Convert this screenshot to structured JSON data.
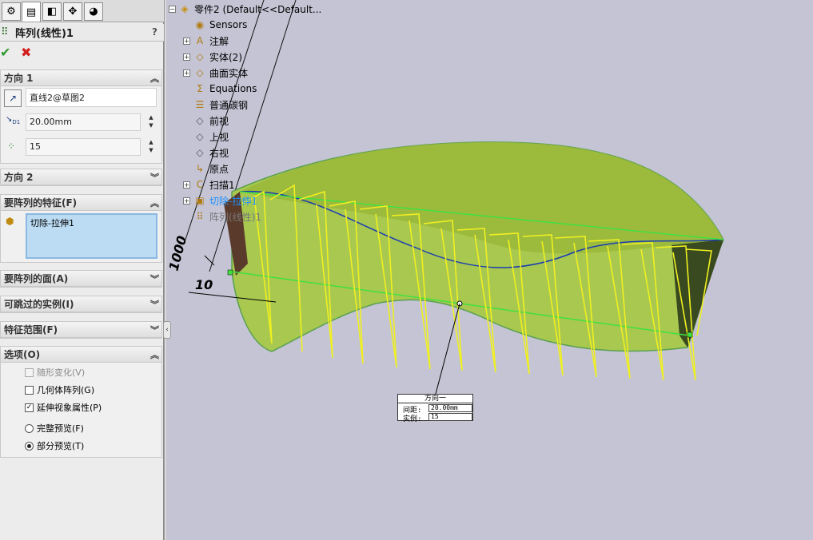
{
  "property_manager": {
    "tabs": [
      "feature-manager-icon",
      "property-manager-icon",
      "configuration-manager-icon",
      "dimxpert-icon",
      "display-manager-icon"
    ],
    "title": "阵列(线性)1",
    "help": "?",
    "ok_glyph": "✔",
    "cancel_glyph": "✖",
    "direction1": {
      "header": "方向 1",
      "direction_ref": "直线2@草图2",
      "spacing": "20.00mm",
      "instances": "15",
      "spacing_label": "D1"
    },
    "direction2": {
      "header": "方向 2"
    },
    "features_to_pattern": {
      "header": "要阵列的特征(F)",
      "items": [
        "切除-拉伸1"
      ]
    },
    "faces_to_pattern": {
      "header": "要阵列的面(A)"
    },
    "instances_to_skip": {
      "header": "可跳过的实例(I)"
    },
    "feature_scope": {
      "header": "特征范围(F)"
    },
    "options": {
      "header": "选项(O)",
      "vary_sketch": "随形变化(V)",
      "geometry_pattern": "几何体阵列(G)",
      "propagate_visual": "延伸视象属性(P)",
      "full_preview": "完整预览(F)",
      "partial_preview": "部分预览(T)"
    }
  },
  "feature_tree": {
    "root": "零件2  (Default<<Default...",
    "items": [
      {
        "label": "Sensors",
        "icon": "sensor-icon",
        "expandable": false
      },
      {
        "label": "注解",
        "icon": "annotations-icon",
        "expandable": true
      },
      {
        "label": "实体(2)",
        "icon": "solid-bodies-icon",
        "expandable": true
      },
      {
        "label": "曲面实体",
        "icon": "surface-bodies-icon",
        "expandable": true
      },
      {
        "label": "Equations",
        "icon": "equations-icon",
        "expandable": false
      },
      {
        "label": "普通碳钢",
        "icon": "material-icon",
        "expandable": false
      },
      {
        "label": "前视",
        "icon": "plane-icon",
        "expandable": false
      },
      {
        "label": "上视",
        "icon": "plane-icon",
        "expandable": false
      },
      {
        "label": "右视",
        "icon": "plane-icon",
        "expandable": false
      },
      {
        "label": "原点",
        "icon": "origin-icon",
        "expandable": false
      },
      {
        "label": "扫描1",
        "icon": "sweep-icon",
        "expandable": true
      },
      {
        "label": "切除-拉伸1",
        "icon": "cut-extrude-icon",
        "expandable": true
      },
      {
        "label": "阵列(线性)1",
        "icon": "linear-pattern-icon",
        "expandable": false
      }
    ]
  },
  "viewport": {
    "dim_1000": "1000",
    "dim_10": "10",
    "callout": {
      "title": "方向一",
      "spacing_label": "间距:",
      "spacing_value": "20.00mm",
      "instances_label": "实例:",
      "instances_value": "15"
    }
  },
  "colors": {
    "viewport_bg": "#c4c4d4",
    "preview_yellow": "#f0f020",
    "surface_green": "#a8c850",
    "edge_blue": "#1a3cb0"
  }
}
